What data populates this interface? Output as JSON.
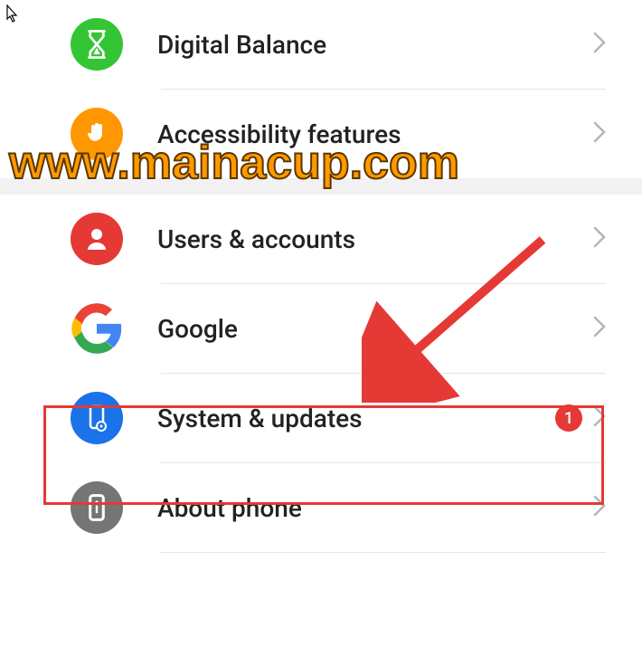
{
  "watermark": "www.mainacup.com",
  "items": [
    {
      "label": "Digital Balance",
      "icon": "hourglass-icon",
      "color": "green",
      "badge": null
    },
    {
      "label": "Accessibility features",
      "icon": "hand-icon",
      "color": "orange",
      "badge": null
    },
    {
      "label": "Users & accounts",
      "icon": "person-icon",
      "color": "red",
      "badge": null
    },
    {
      "label": "Google",
      "icon": "google-icon",
      "color": "white",
      "badge": null
    },
    {
      "label": "System & updates",
      "icon": "phone-gear-icon",
      "color": "blue",
      "badge": "1"
    },
    {
      "label": "About phone",
      "icon": "phone-info-icon",
      "color": "grey",
      "badge": null
    }
  ],
  "highlighted_item_index": 4
}
